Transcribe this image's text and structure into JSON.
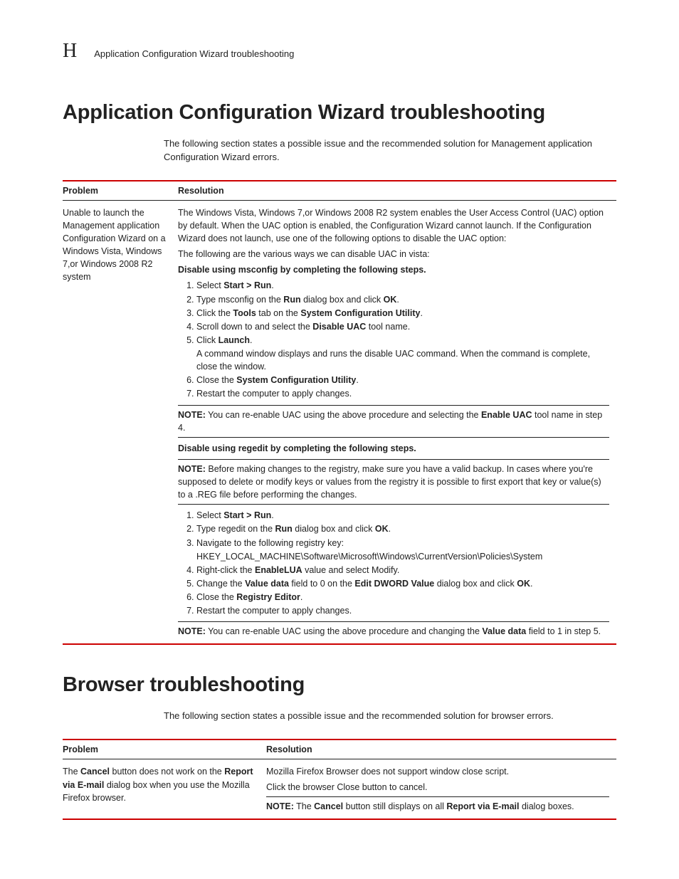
{
  "header": {
    "letter": "H",
    "running_title": "Application Configuration Wizard troubleshooting"
  },
  "section1": {
    "title": "Application Configuration Wizard troubleshooting",
    "intro": "The following section states a possible issue and the recommended solution for Management application Configuration Wizard errors.",
    "th_problem": "Problem",
    "th_resolution": "Resolution",
    "problem": "Unable to launch the Management application Configuration Wizard on a Windows Vista, Windows 7,or Windows 2008 R2 system",
    "res": {
      "p1": "The Windows Vista, Windows 7,or Windows 2008 R2 system enables the User Access Control (UAC) option by default. When the UAC option is enabled, the Configuration Wizard cannot launch. If the Configuration Wizard does not launch, use one of the following options to disable the UAC option:",
      "p2": "The following are the various ways we can disable UAC in vista:",
      "sub1": "Disable using msconfig by completing the following steps.",
      "s1_1a": "Select ",
      "s1_1b": "Start > Run",
      "s1_1c": ".",
      "s1_2a": "Type msconfig on the ",
      "s1_2b": "Run",
      "s1_2c": " dialog box and click ",
      "s1_2d": "OK",
      "s1_2e": ".",
      "s1_3a": "Click the ",
      "s1_3b": "Tools",
      "s1_3c": " tab on the ",
      "s1_3d": "System Configuration Utility",
      "s1_3e": ".",
      "s1_4a": "Scroll down to and select the ",
      "s1_4b": "Disable UAC",
      "s1_4c": " tool name.",
      "s1_5a": "Click ",
      "s1_5b": "Launch",
      "s1_5c": ".",
      "s1_5d": "A command window displays and runs the disable UAC command. When the command is complete, close the window.",
      "s1_6a": "Close the ",
      "s1_6b": "System Configuration Utility",
      "s1_6c": ".",
      "s1_7": "Restart the computer to apply changes.",
      "note1a": "NOTE:",
      "note1b": "  You can re-enable UAC using the above procedure and selecting the ",
      "note1c": "Enable UAC",
      "note1d": " tool name in step 4.",
      "sub2": "Disable using regedit by completing the following steps.",
      "note2a": "NOTE:",
      "note2b": "  Before making changes to the registry, make sure you have a valid backup. In cases where you're supposed to delete or modify keys or values from the registry it is possible to first export that key or value(s) to a .REG file before performing the changes.",
      "s2_1a": "Select ",
      "s2_1b": "Start > Run",
      "s2_1c": ".",
      "s2_2a": "Type regedit on the ",
      "s2_2b": "Run",
      "s2_2c": " dialog box and click ",
      "s2_2d": "OK",
      "s2_2e": ".",
      "s2_3a": "Navigate to the following registry key:",
      "s2_3b": "HKEY_LOCAL_MACHINE\\Software\\Microsoft\\Windows\\CurrentVersion\\Policies\\System",
      "s2_4a": "Right-click the ",
      "s2_4b": "EnableLUA",
      "s2_4c": " value and select Modify.",
      "s2_5a": "Change the ",
      "s2_5b": "Value data",
      "s2_5c": " field to 0 on the ",
      "s2_5d": "Edit DWORD Value",
      "s2_5e": " dialog box and click ",
      "s2_5f": "OK",
      "s2_5g": ".",
      "s2_6a": "Close the ",
      "s2_6b": "Registry Editor",
      "s2_6c": ".",
      "s2_7": "Restart the computer to apply changes.",
      "note3a": "NOTE:",
      "note3b": "  You can re-enable UAC using the above procedure and changing the ",
      "note3c": "Value data",
      "note3d": " field to 1 in step 5."
    }
  },
  "section2": {
    "title": "Browser troubleshooting",
    "intro": "The following section states a possible issue and the recommended solution for browser errors.",
    "th_problem": "Problem",
    "th_resolution": "Resolution",
    "problem_a": "The ",
    "problem_b": "Cancel",
    "problem_c": " button does not work on the ",
    "problem_d": "Report via E-mail",
    "problem_e": " dialog box when you use the Mozilla Firefox browser.",
    "res_p1": "Mozilla Firefox Browser does not support window close script.",
    "res_p2": "Click the browser Close button to cancel.",
    "res_note_a": "NOTE:",
    "res_note_b": "  The ",
    "res_note_c": "Cancel",
    "res_note_d": " button still displays on all ",
    "res_note_e": "Report via E-mail",
    "res_note_f": " dialog boxes."
  }
}
